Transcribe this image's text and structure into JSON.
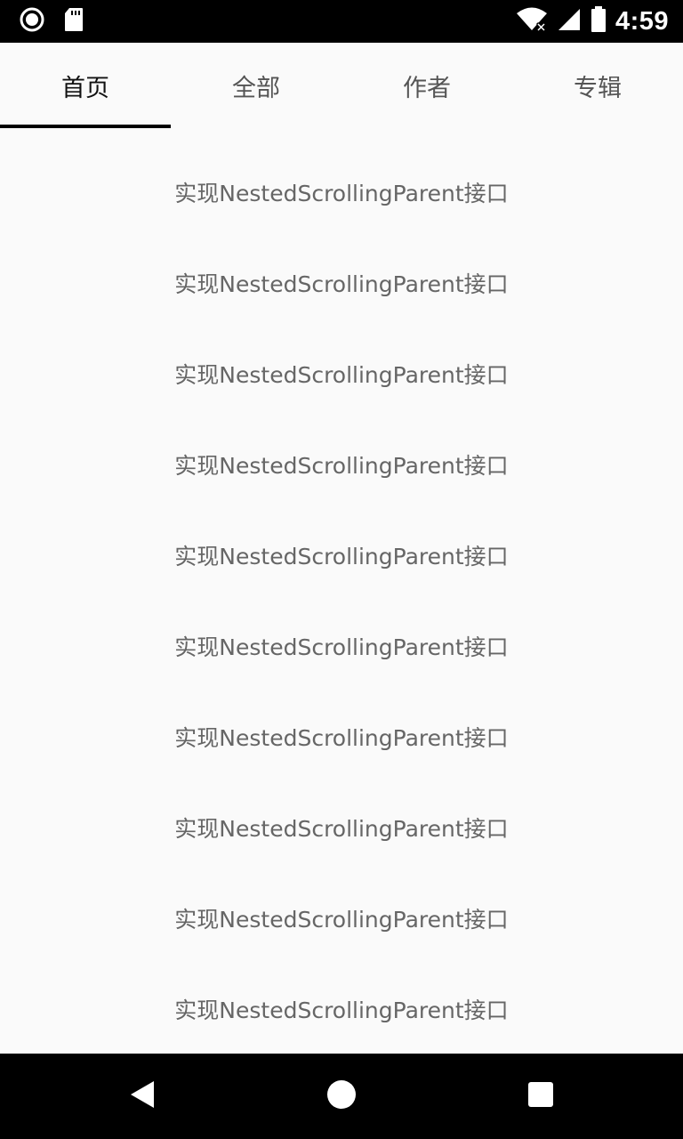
{
  "status_bar": {
    "time": "4:59",
    "icons": [
      "record-icon",
      "sd-card-icon",
      "wifi-icon",
      "signal-icon",
      "battery-icon"
    ]
  },
  "tabs": [
    {
      "label": "首页",
      "active": true
    },
    {
      "label": "全部",
      "active": false
    },
    {
      "label": "作者",
      "active": false
    },
    {
      "label": "专辑",
      "active": false
    }
  ],
  "list": {
    "items": [
      "实现NestedScrollingParent接口",
      "实现NestedScrollingParent接口",
      "实现NestedScrollingParent接口",
      "实现NestedScrollingParent接口",
      "实现NestedScrollingParent接口",
      "实现NestedScrollingParent接口",
      "实现NestedScrollingParent接口",
      "实现NestedScrollingParent接口",
      "实现NestedScrollingParent接口",
      "实现NestedScrollingParent接口"
    ]
  },
  "nav_bar": {
    "buttons": [
      "back-icon",
      "home-icon",
      "recents-icon"
    ]
  },
  "colors": {
    "background": "#fafafa",
    "indicator": "#000000",
    "text_item": "#666666",
    "tab_inactive": "#555555",
    "tab_active": "#111111"
  }
}
